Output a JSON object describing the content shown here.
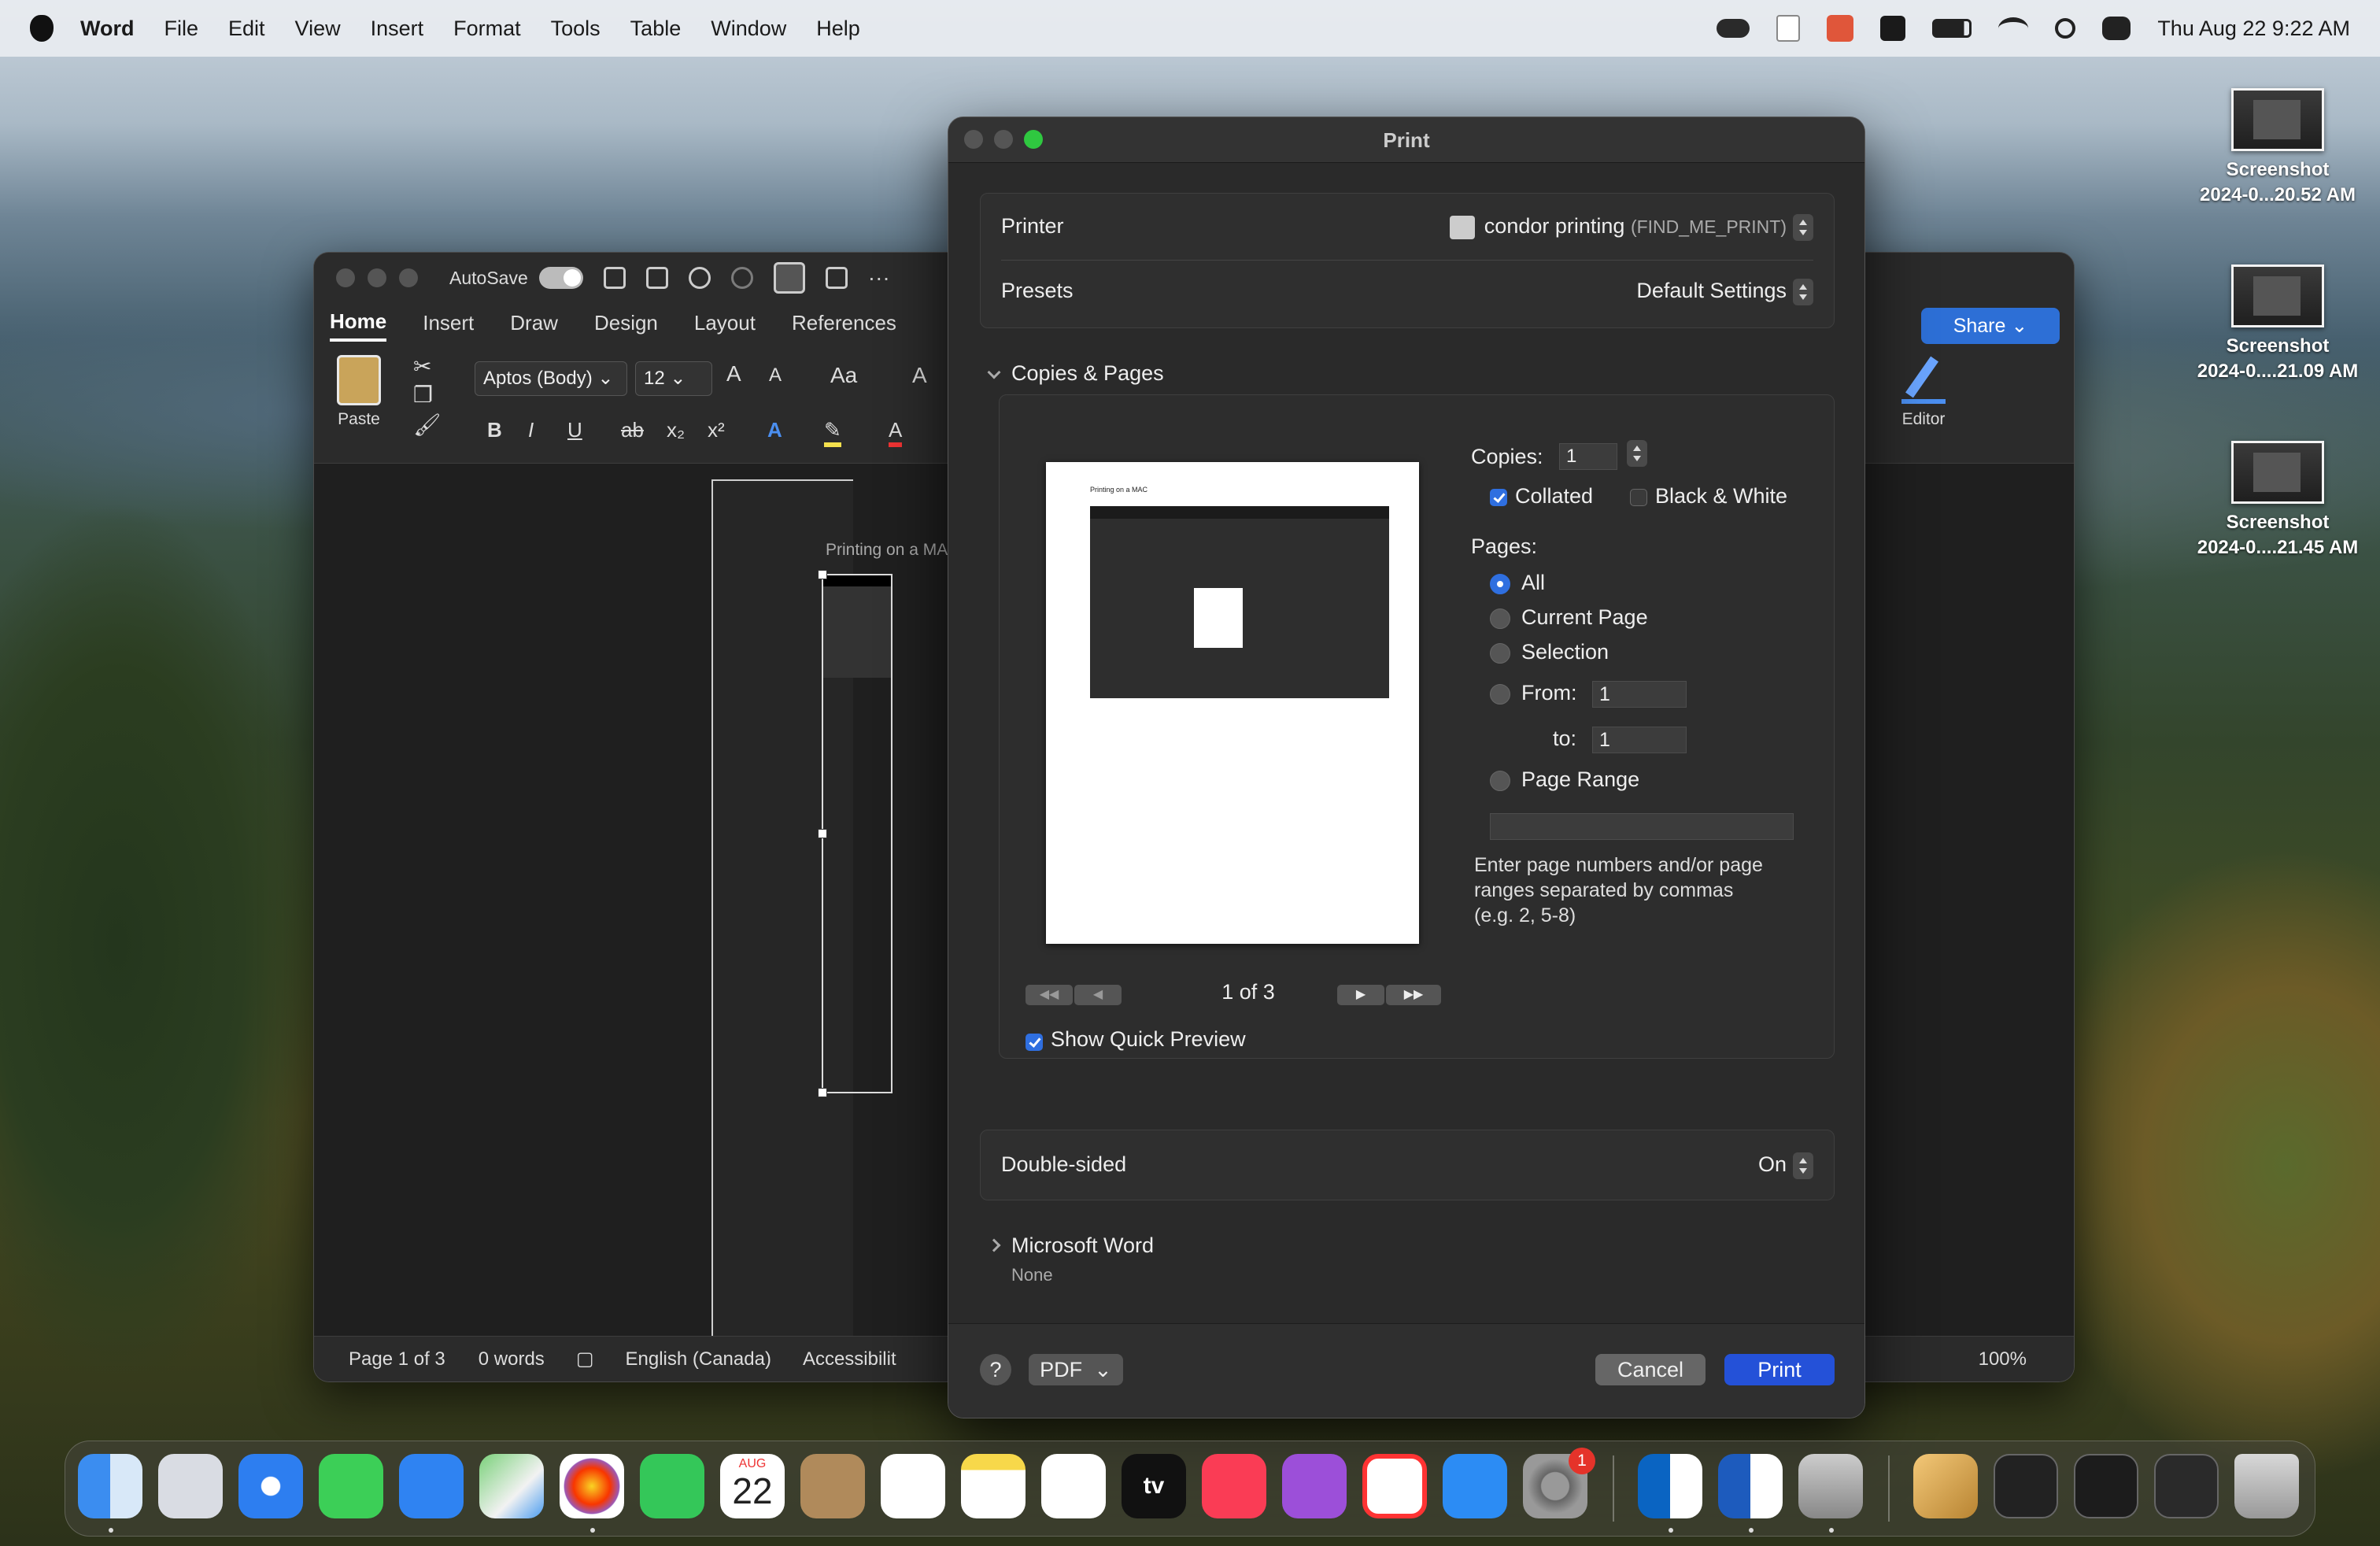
{
  "menubar": {
    "app": "Word",
    "items": [
      "File",
      "Edit",
      "View",
      "Insert",
      "Format",
      "Tools",
      "Table",
      "Window",
      "Help"
    ],
    "clock": "Thu Aug 22  9:22 AM"
  },
  "desktop": {
    "icons": [
      {
        "line1": "Screenshot",
        "line2": "2024-0...20.52 AM"
      },
      {
        "line1": "Screenshot",
        "line2": "2024-0....21.09 AM"
      },
      {
        "line1": "Screenshot",
        "line2": "2024-0....21.45 AM"
      }
    ]
  },
  "word": {
    "autosave": "AutoSave",
    "tabs": [
      "Home",
      "Insert",
      "Draw",
      "Design",
      "Layout",
      "References"
    ],
    "paste": "Paste",
    "font": "Aptos (Body)",
    "size": "12",
    "editor": "Editor",
    "share": "Share",
    "doc_heading": "Printing on a MA",
    "status": {
      "page": "Page 1 of 3",
      "words": "0 words",
      "language": "English (Canada)",
      "accessibility": "Accessibilit",
      "zoom": "100%"
    }
  },
  "print": {
    "title": "Print",
    "printer_label": "Printer",
    "printer_name": "condor printing",
    "printer_id": "(FIND_ME_PRINT)",
    "presets_label": "Presets",
    "presets_value": "Default Settings",
    "copies_pages": "Copies & Pages",
    "preview_text": "Printing on a MAC",
    "page_count": "1 of 3",
    "copies_label": "Copies:",
    "copies_value": "1",
    "collated": "Collated",
    "bw": "Black & White",
    "pages_label": "Pages:",
    "opt_all": "All",
    "opt_current": "Current Page",
    "opt_selection": "Selection",
    "opt_from": "From:",
    "from_value": "1",
    "to_label": "to:",
    "to_value": "1",
    "opt_range": "Page Range",
    "range_hint": "Enter page numbers and/or page ranges separated by commas (e.g. 2, 5-8)",
    "show_preview": "Show Quick Preview",
    "double_sided_label": "Double-sided",
    "double_sided_value": "On",
    "ms_word": "Microsoft Word",
    "ms_word_sub": "None",
    "help": "?",
    "pdf": "PDF",
    "cancel": "Cancel",
    "print_btn": "Print"
  },
  "dock": {
    "calendar_month": "AUG",
    "calendar_day": "22",
    "settings_badge": "1",
    "tv_label": "tv"
  }
}
